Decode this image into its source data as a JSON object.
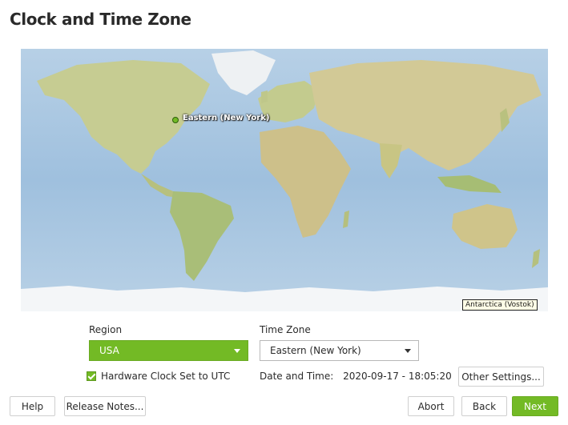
{
  "page": {
    "title": "Clock and Time Zone"
  },
  "map": {
    "selected_city_label": "Eastern (New York)",
    "hover_tooltip": "Antarctica (Vostok)"
  },
  "region": {
    "label": "Region",
    "value": "USA"
  },
  "timezone": {
    "label": "Time Zone",
    "value": "Eastern (New York)"
  },
  "hardware_clock": {
    "label": "Hardware Clock Set to UTC",
    "checked": true
  },
  "datetime": {
    "label": "Date and Time:",
    "value": "2020-09-17 - 18:05:20"
  },
  "buttons": {
    "other_settings": "Other Settings...",
    "help": "Help",
    "release_notes": "Release Notes...",
    "abort": "Abort",
    "back": "Back",
    "next": "Next"
  },
  "colors": {
    "accent": "#73ba25",
    "ocean": "#a9c6e0",
    "land": "#c9cf98"
  }
}
